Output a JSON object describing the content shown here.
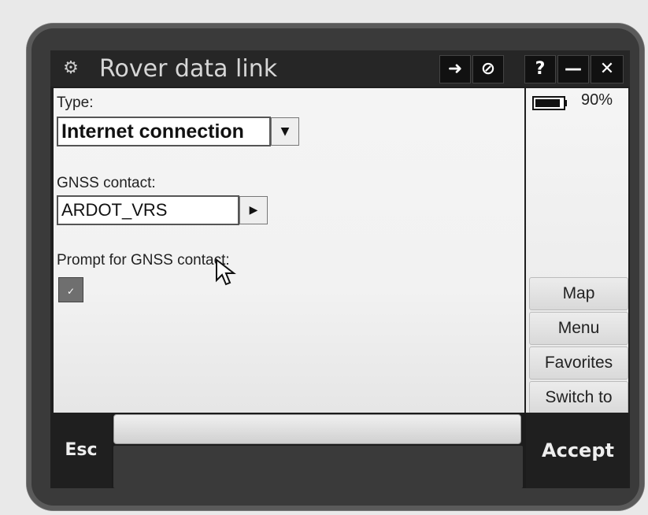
{
  "window": {
    "title": "Rover data link",
    "app_icon": "gear-wheel-icon",
    "buttons": [
      {
        "label": "➜",
        "icon": "arrow-right-icon"
      },
      {
        "label": "⊘",
        "icon": "no-entry-icon"
      },
      {
        "label": "?",
        "icon": "help-icon"
      },
      {
        "label": "—",
        "icon": "minimize-icon"
      },
      {
        "label": "✕",
        "icon": "close-icon"
      }
    ]
  },
  "form": {
    "type_label": "Type:",
    "type_value": "Internet connection",
    "gnss_label": "GNSS contact:",
    "gnss_value": "ARDOT_VRS",
    "prompt_label": "Prompt for GNSS contact:",
    "prompt_checked": true
  },
  "status": {
    "battery_percent": "90%",
    "battery_level": 0.9
  },
  "side_buttons": [
    {
      "label": "Map"
    },
    {
      "label": "Menu"
    },
    {
      "label": "Favorites"
    },
    {
      "label": "Switch to"
    }
  ],
  "footer": {
    "esc_label": "Esc",
    "accept_label": "Accept"
  },
  "colors": {
    "device": "#3a3a3a",
    "titlebar": "#262626",
    "content": "#f2f2f2"
  }
}
